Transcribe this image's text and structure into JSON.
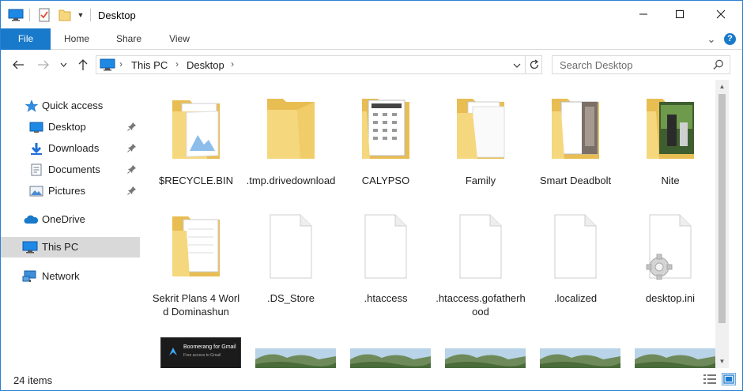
{
  "window": {
    "title": "Desktop",
    "controls": {
      "minimize": "—",
      "maximize": "☐",
      "close": "✕"
    }
  },
  "ribbon": {
    "tabs": [
      "File",
      "Home",
      "Share",
      "View"
    ],
    "chevron": "⌄",
    "help": "?"
  },
  "address": {
    "breadcrumbs": [
      "This PC",
      "Desktop"
    ],
    "search_placeholder": "Search Desktop"
  },
  "nav": {
    "quick_access": "Quick access",
    "pinned": [
      {
        "label": "Desktop",
        "icon": "desktop-icon"
      },
      {
        "label": "Downloads",
        "icon": "downloads-icon"
      },
      {
        "label": "Documents",
        "icon": "documents-icon"
      },
      {
        "label": "Pictures",
        "icon": "pictures-icon"
      }
    ],
    "onedrive": "OneDrive",
    "this_pc": "This PC",
    "network": "Network"
  },
  "files": [
    {
      "name": "$RECYCLE.BIN",
      "icon": "folder-with-pictures-icon"
    },
    {
      "name": ".tmp.drivedownload",
      "icon": "folder-icon"
    },
    {
      "name": "CALYPSO",
      "icon": "folder-with-document-icon"
    },
    {
      "name": "Family",
      "icon": "folder-with-documents-icon"
    },
    {
      "name": "Smart Deadbolt",
      "icon": "folder-with-images-icon"
    },
    {
      "name": "Nite",
      "icon": "folder-with-photo-icon"
    },
    {
      "name": "Sekrit Plans 4 World Dominashun",
      "icon": "folder-with-documents-icon"
    },
    {
      "name": ".DS_Store",
      "icon": "blank-file-icon"
    },
    {
      "name": ".htaccess",
      "icon": "blank-file-icon"
    },
    {
      "name": ".htaccess.gofatherhood",
      "icon": "blank-file-icon"
    },
    {
      "name": ".localized",
      "icon": "blank-file-icon"
    },
    {
      "name": "desktop.ini",
      "icon": "settings-file-icon"
    }
  ],
  "partial_row": [
    {
      "caption": "Boomerang for Gmail",
      "subcaption": "Free access to Gmail",
      "icon": "boomerang-thumbnail"
    },
    {
      "icon": "landscape-thumbnail"
    },
    {
      "icon": "landscape-thumbnail"
    },
    {
      "icon": "landscape-thumbnail"
    },
    {
      "icon": "landscape-thumbnail"
    },
    {
      "icon": "landscape-thumbnail"
    }
  ],
  "status": {
    "count": "24 items"
  },
  "colors": {
    "accent": "#1979ca",
    "folder": "#f5d77e",
    "folder_dark": "#e8bd52",
    "selection": "#d9d9d9"
  }
}
